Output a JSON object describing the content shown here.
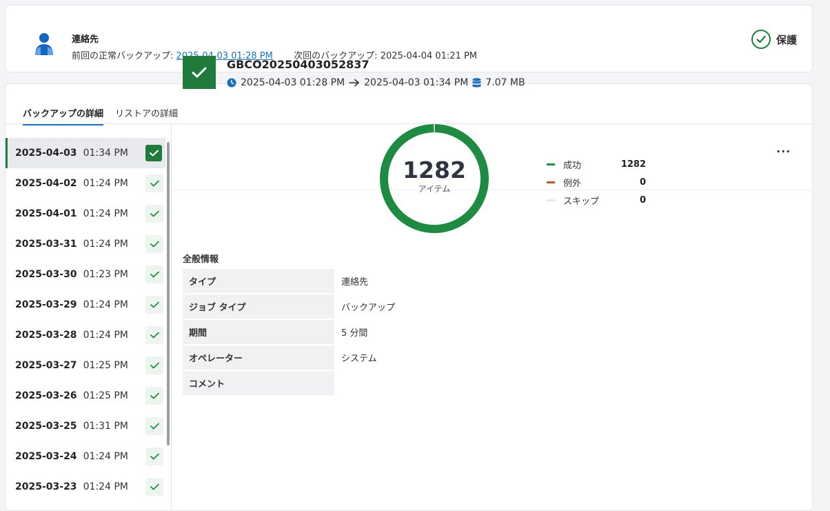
{
  "header": {
    "title": "連絡先",
    "last_backup_label": "前回の正常バックアップ:",
    "last_backup_value": "2025-04-03 01:28 PM",
    "next_backup_label": "次回のバックアップ:",
    "next_backup_value": "2025-04-04 01:21 PM",
    "status_label": "保護",
    "avatar_icon": "user-icon",
    "status_icon": "check-circle-icon",
    "colors": {
      "accent": "#1f7a3c",
      "link": "#1a6fb8",
      "avatar": "#1565c0"
    }
  },
  "tabs": [
    {
      "label": "バックアップの詳細",
      "active": true
    },
    {
      "label": "リストアの詳細",
      "active": false
    }
  ],
  "backups": [
    {
      "date": "2025-04-03",
      "time": "01:34 PM",
      "selected": true
    },
    {
      "date": "2025-04-02",
      "time": "01:24 PM"
    },
    {
      "date": "2025-04-01",
      "time": "01:24 PM"
    },
    {
      "date": "2025-03-31",
      "time": "01:24 PM"
    },
    {
      "date": "2025-03-30",
      "time": "01:23 PM"
    },
    {
      "date": "2025-03-29",
      "time": "01:24 PM"
    },
    {
      "date": "2025-03-28",
      "time": "01:24 PM"
    },
    {
      "date": "2025-03-27",
      "time": "01:25 PM"
    },
    {
      "date": "2025-03-26",
      "time": "01:25 PM"
    },
    {
      "date": "2025-03-25",
      "time": "01:31 PM"
    },
    {
      "date": "2025-03-24",
      "time": "01:24 PM"
    },
    {
      "date": "2025-03-23",
      "time": "01:24 PM"
    }
  ],
  "detail": {
    "job_name": "GBCO20250403052837",
    "start": "2025-04-03 01:28 PM",
    "end": "2025-04-03 01:34 PM",
    "size": "7.07 MB",
    "more_label": "···",
    "icons": {
      "start": "clock-icon",
      "arrow": "arrow-right-icon",
      "size": "database-icon"
    }
  },
  "summary": {
    "total": "1282",
    "total_label": "アイテム",
    "items": [
      {
        "label": "成功",
        "value": 1282,
        "color": "#1f8a42"
      },
      {
        "label": "例外",
        "value": 0,
        "color": "#b55a2a"
      },
      {
        "label": "スキップ",
        "value": 0,
        "color": "#e6e7e9"
      }
    ]
  },
  "general_info": {
    "title": "全般情報",
    "rows": [
      {
        "key": "タイプ",
        "value": "連絡先"
      },
      {
        "key": "ジョブ タイプ",
        "value": "バックアップ"
      },
      {
        "key": "期間",
        "value": "5 分間"
      },
      {
        "key": "オペレーター",
        "value": "システム"
      },
      {
        "key": "コメント",
        "value": ""
      }
    ]
  }
}
